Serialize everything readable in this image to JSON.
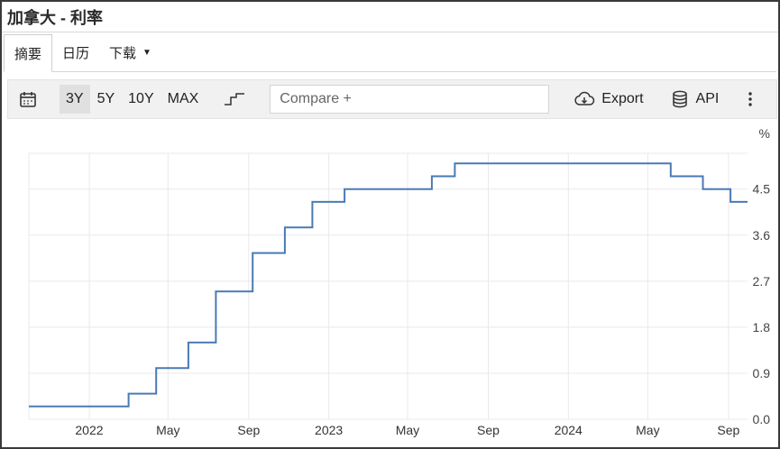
{
  "header": {
    "title": "加拿大 - 利率"
  },
  "tabs": [
    {
      "label": "摘要",
      "active": true
    },
    {
      "label": "日历",
      "active": false
    },
    {
      "label": "下载",
      "active": false
    }
  ],
  "toolbar": {
    "calendar_icon": "calendar-icon",
    "ranges": [
      {
        "label": "3Y",
        "active": true
      },
      {
        "label": "5Y",
        "active": false
      },
      {
        "label": "10Y",
        "active": false
      },
      {
        "label": "MAX",
        "active": false
      }
    ],
    "step_icon": "step-chart-icon",
    "compare_placeholder": "Compare +",
    "export_label": "Export",
    "api_label": "API",
    "more_icon": "more-vertical-icon"
  },
  "colors": {
    "line": "#4a7ab5",
    "grid": "#e9e9e9",
    "toolbar_bg": "#f1f1f1"
  },
  "chart_data": {
    "type": "line",
    "step": true,
    "unit": "%",
    "grid": true,
    "y_axis_position": "right",
    "ylim": [
      0,
      5.2
    ],
    "y_ticks": [
      0.0,
      0.9,
      1.8,
      2.7,
      3.6,
      4.5
    ],
    "y_tick_labels": [
      "0.0",
      "0.9",
      "1.8",
      "2.7",
      "3.6",
      "4.5"
    ],
    "x_ticks": [
      "2022-01-01",
      "2022-05-01",
      "2022-09-01",
      "2023-01-01",
      "2023-05-01",
      "2023-09-01",
      "2024-01-01",
      "2024-05-01",
      "2024-09-01"
    ],
    "x_tick_labels": [
      "2022",
      "May",
      "Sep",
      "2023",
      "May",
      "Sep",
      "2024",
      "May",
      "Sep"
    ],
    "xlim": [
      "2021-10-01",
      "2024-09-30"
    ],
    "series": [
      {
        "x": [
          "2021-10-01",
          "2022-03-02",
          "2022-04-13",
          "2022-06-01",
          "2022-07-13",
          "2022-09-07",
          "2022-10-26",
          "2022-12-07",
          "2023-01-25",
          "2023-06-07",
          "2023-07-12",
          "2024-06-05",
          "2024-07-24",
          "2024-09-04",
          "2024-09-30"
        ],
        "values": [
          0.25,
          0.5,
          1.0,
          1.5,
          2.5,
          3.25,
          3.75,
          4.25,
          4.5,
          4.75,
          5.0,
          4.75,
          4.5,
          4.25,
          4.25
        ]
      }
    ]
  }
}
